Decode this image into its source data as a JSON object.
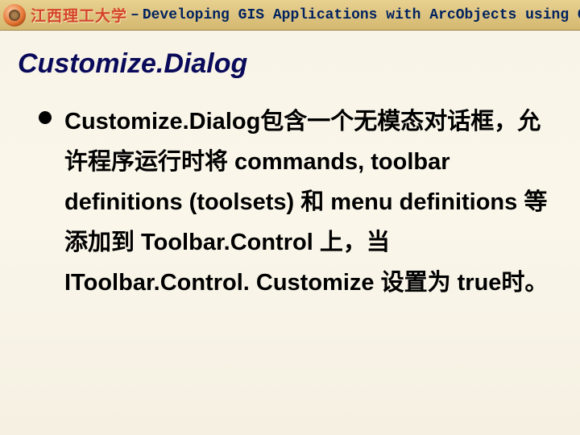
{
  "header": {
    "university_cn": "江西理工大学",
    "separator": "–",
    "course_en": "Developing GIS Applications with ArcObjects using C#.NET"
  },
  "slide": {
    "title": "Customize.Dialog"
  },
  "content": {
    "bullet1": "Customize.Dialog包含一个无模态对话框，允许程序运行时将 commands, toolbar definitions (toolsets) 和 menu definitions 等添加到 Toolbar.Control 上，当 IToolbar.Control. Customize 设置为 true时。"
  }
}
